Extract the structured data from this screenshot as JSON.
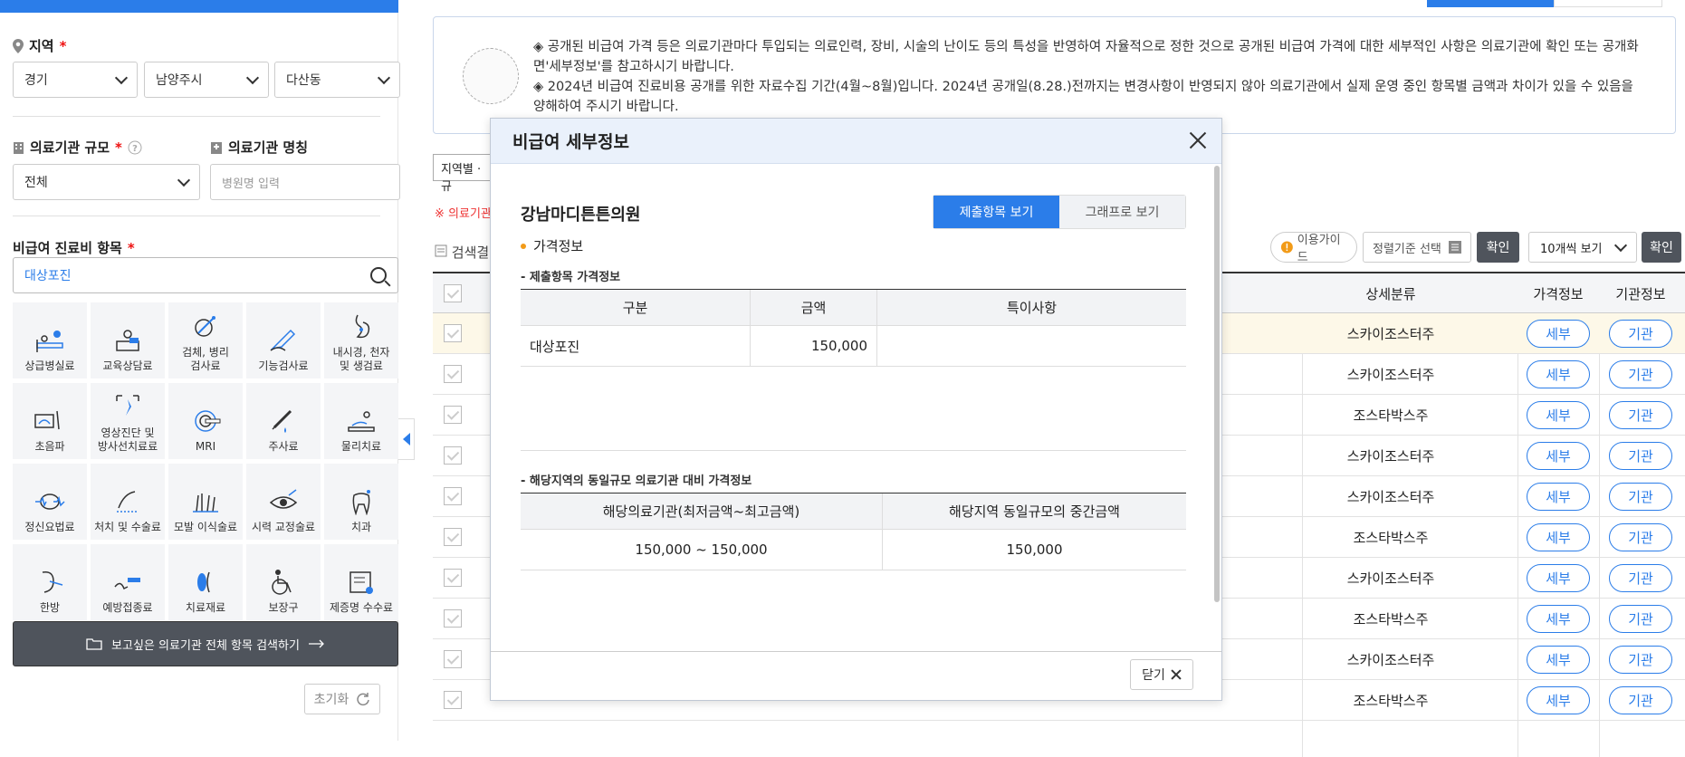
{
  "left": {
    "region": {
      "label": "지역",
      "required": "*",
      "sido": "경기",
      "sigungu": "남양주시",
      "dong": "다산동"
    },
    "scale": {
      "label": "의료기관 규모",
      "required": "*",
      "value": "전체"
    },
    "hospital_name": {
      "label": "의료기관 명칭",
      "placeholder": "병원명 입력"
    },
    "items": {
      "label": "비급여 진료비 항목",
      "required": "*",
      "search_value": "대상포진"
    },
    "categories": [
      {
        "label": "상급병실료",
        "icon": "bed-icon"
      },
      {
        "label": "교육상담료",
        "icon": "consult-icon"
      },
      {
        "label": "검체, 병리\n검사료",
        "icon": "specimen-icon"
      },
      {
        "label": "기능검사료",
        "icon": "function-test-icon"
      },
      {
        "label": "내시경, 천자\n및 생검료",
        "icon": "endoscope-icon"
      },
      {
        "label": "초음파",
        "icon": "ultrasound-icon"
      },
      {
        "label": "영상진단 및\n방사선치료료",
        "icon": "imaging-icon"
      },
      {
        "label": "MRI",
        "icon": "mri-icon"
      },
      {
        "label": "주사료",
        "icon": "syringe-icon"
      },
      {
        "label": "물리치료",
        "icon": "physio-icon"
      },
      {
        "label": "정신요법료",
        "icon": "brain-icon"
      },
      {
        "label": "처치 및 수술료",
        "icon": "surgery-icon"
      },
      {
        "label": "모발 이식술료",
        "icon": "hair-icon"
      },
      {
        "label": "시력 교정술료",
        "icon": "eye-icon"
      },
      {
        "label": "치과",
        "icon": "tooth-icon"
      },
      {
        "label": "한방",
        "icon": "acupuncture-icon"
      },
      {
        "label": "예방접종료",
        "icon": "vaccine-icon"
      },
      {
        "label": "치료재료",
        "icon": "material-icon"
      },
      {
        "label": "보장구",
        "icon": "wheelchair-icon"
      },
      {
        "label": "제증명 수수료",
        "icon": "certificate-icon"
      }
    ],
    "search_all_label": "보고싶은 의료기관 전체 항목 검색하기",
    "reset_label": "초기화"
  },
  "notice": {
    "line1": "◈ 공개된 비급여 가격 등은 의료기관마다 투입되는 의료인력, 장비, 시술의 난이도 등의 특성을 반영하여 자율적으로 정한 것으로 공개된 비급여 가격에 대한 세부적인 사항은 의료기관에 확인 또는 공개화면'세부정보'를 참고하시기 바랍니다.",
    "line2": "◈ 2024년 비급여 진료비용 공개를 위한 자료수집 기간(4월~8월)입니다. 2024년 공개일(8.28.)전까지는 변경사항이 반영되지 않아 의료기관에서 실제 운영 중인 항목별 금액과 차이가 있을 수 있음을 양해하여 주시기 바랍니다."
  },
  "toolbar": {
    "region_tab": "지역별 · 규",
    "red_note": "※ 의료기관",
    "result_label": "검색결",
    "guide": "이용가이드",
    "sort": "정렬기준 선택",
    "confirm": "확인",
    "per_page": "10개씩 보기",
    "confirm2": "확인"
  },
  "table": {
    "headers": {
      "sub": "상세분류",
      "price": "가격정보",
      "inst": "기관정보"
    },
    "rows": [
      {
        "sub": "스카이조스터주",
        "price_btn": "세부",
        "inst_btn": "기관"
      },
      {
        "sub": "스카이조스터주",
        "price_btn": "세부",
        "inst_btn": "기관"
      },
      {
        "sub": "조스타박스주",
        "price_btn": "세부",
        "inst_btn": "기관"
      },
      {
        "sub": "스카이조스터주",
        "price_btn": "세부",
        "inst_btn": "기관"
      },
      {
        "sub": "스카이조스터주",
        "price_btn": "세부",
        "inst_btn": "기관"
      },
      {
        "sub": "조스타박스주",
        "price_btn": "세부",
        "inst_btn": "기관"
      },
      {
        "sub": "스카이조스터주",
        "price_btn": "세부",
        "inst_btn": "기관"
      },
      {
        "sub": "조스타박스주",
        "price_btn": "세부",
        "inst_btn": "기관"
      },
      {
        "sub": "스카이조스터주",
        "price_btn": "세부",
        "inst_btn": "기관"
      },
      {
        "sub": "조스타박스주",
        "price_btn": "세부",
        "inst_btn": "기관"
      }
    ]
  },
  "modal": {
    "title": "비급여 세부정보",
    "hospital": "강남마디튼튼의원",
    "tab_submitted": "제출항목 보기",
    "tab_graph": "그래프로 보기",
    "section": "가격정보",
    "caption1": "- 제출항목 가격정보",
    "t1_headers": {
      "category": "구분",
      "amount": "금액",
      "note": "특이사항"
    },
    "t1_row": {
      "category": "대상포진",
      "amount": "150,000",
      "note": ""
    },
    "caption2": "- 해당지역의 동일규모 의료기관 대비 가격정보",
    "t2_headers": {
      "range": "해당의료기관(최저금액~최고금액)",
      "median": "해당지역 동일규모의 중간금액"
    },
    "t2_row": {
      "range": "150,000 ~ 150,000",
      "median": "150,000"
    },
    "close_label": "닫기"
  },
  "colors": {
    "primary": "#2b7de9",
    "dark_button": "#4f545c",
    "required": "#e11111",
    "highlight_row": "#fdf8e8"
  }
}
